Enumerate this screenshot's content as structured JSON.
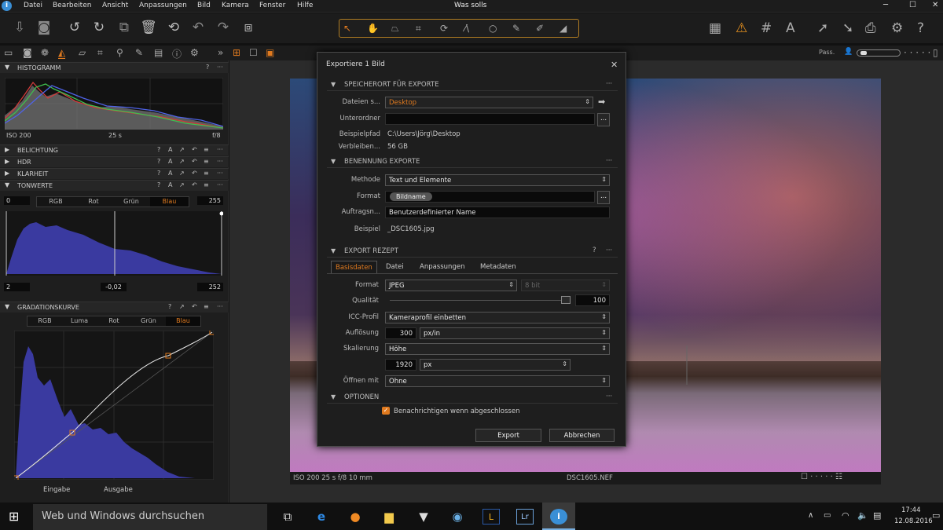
{
  "app": {
    "title": "Was solls",
    "menu": [
      "Datei",
      "Bearbeiten",
      "Ansicht",
      "Anpassungen",
      "Bild",
      "Kamera",
      "Fenster",
      "Hilfe"
    ]
  },
  "tabsrow": {
    "pass_label": "Pass."
  },
  "left": {
    "histogram": {
      "title": "HISTOGRAMM",
      "iso": "ISO 200",
      "shutter": "25 s",
      "aperture": "f/8"
    },
    "sections": {
      "exposure": "BELICHTUNG",
      "hdr": "HDR",
      "clarity": "KLARHEIT"
    },
    "levels": {
      "title": "TONWERTE",
      "channels": [
        "RGB",
        "Rot",
        "Grün",
        "Blau"
      ],
      "active_channel": "Blau",
      "in_low": "0",
      "in_high": "255",
      "out_low": "2",
      "mid": "-0,02",
      "out_high": "252"
    },
    "curve": {
      "title": "GRADATIONSKURVE",
      "channels": [
        "RGB",
        "Luma",
        "Rot",
        "Grün",
        "Blau"
      ],
      "active_channel": "Blau",
      "input_label": "Eingabe",
      "output_label": "Ausgabe"
    }
  },
  "dialog": {
    "title": "Exportiere 1 Bild",
    "location": {
      "section": "SPEICHERORT FÜR EXPORTE",
      "dest_label": "Dateien s...",
      "dest_value": "Desktop",
      "subfolder_label": "Unterordner",
      "subfolder_value": "",
      "path_label": "Beispielpfad",
      "path_value": "C:\\Users\\Jörg\\Desktop",
      "remaining_label": "Verbleiben...",
      "remaining_value": "56 GB"
    },
    "naming": {
      "section": "BENENNUNG EXPORTE",
      "method_label": "Methode",
      "method_value": "Text und Elemente",
      "format_label": "Format",
      "format_token": "Bildname",
      "job_label": "Auftragsn...",
      "job_value": "Benutzerdefinierter Name",
      "example_label": "Beispiel",
      "example_value": "_DSC1605.jpg"
    },
    "recipe": {
      "section": "EXPORT REZEPT",
      "tabs": [
        "Basisdaten",
        "Datei",
        "Anpassungen",
        "Metadaten"
      ],
      "format_label": "Format",
      "format_value": "JPEG",
      "bitdepth": "8 bit",
      "quality_label": "Qualität",
      "quality_value": "100",
      "icc_label": "ICC-Profil",
      "icc_value": "Kameraprofil einbetten",
      "res_label": "Auflösung",
      "res_value": "300",
      "res_unit": "px/in",
      "scale_label": "Skalierung",
      "scale_value": "Höhe",
      "scale_size": "1920",
      "scale_unit": "px",
      "open_label": "Öffnen mit",
      "open_value": "Ohne"
    },
    "options": {
      "section": "OPTIONEN",
      "notify_label": "Benachrichtigen wenn abgeschlossen",
      "notify_checked": true
    },
    "buttons": {
      "export": "Export",
      "cancel": "Abbrechen"
    }
  },
  "viewer": {
    "status_left": "ISO 200 25 s f/8 10 mm",
    "filename": "DSC1605.NEF"
  },
  "taskbar": {
    "search_placeholder": "Web und Windows durchsuchen",
    "time": "17:44",
    "date": "12.08.2016"
  },
  "colors": {
    "accent": "#e07a1f",
    "dialog_bg": "#1e1e1e",
    "panel_bg": "#1e1e1e",
    "histogram_blue": "#3a3aa0"
  }
}
